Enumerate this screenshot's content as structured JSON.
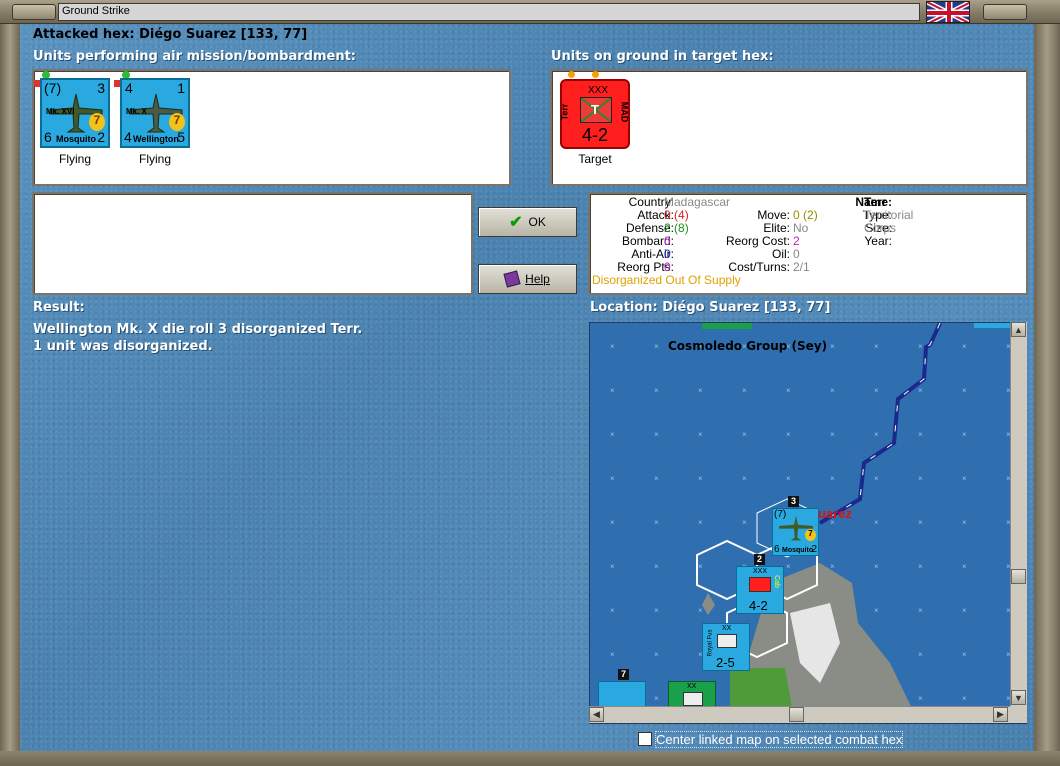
{
  "window": {
    "title": "Ground Strike"
  },
  "header": {
    "attacked_hex_label": "Attacked hex:",
    "attacked_hex_value": "Diégo Suarez  [133, 77]"
  },
  "air_units": {
    "heading": "Units performing air mission/bombardment:",
    "units": [
      {
        "name": "Mosquito",
        "model": "Mk. XVI",
        "top_left": "(7)",
        "top_right": "3",
        "bottom_left": "6",
        "bottom_right": "2",
        "badge": "7",
        "status": "Flying"
      },
      {
        "name": "Wellington",
        "model": "Mk. X",
        "top_left": "4",
        "top_right": "1",
        "bottom_left": "4",
        "bottom_right": "5",
        "badge": "7",
        "status": "Flying"
      }
    ]
  },
  "ground_units": {
    "heading": "Units on ground in target hex:",
    "units": [
      {
        "size": "XXX",
        "left_label": "Terr",
        "right_label": "MAD",
        "symbol": "T",
        "strength": "4-2",
        "status": "Target"
      }
    ]
  },
  "buttons": {
    "ok": "OK",
    "help": "Help"
  },
  "stats": {
    "country_label": "Country:",
    "country": "Madagascar",
    "attack_label": "Attack:",
    "attack": "0",
    "attack_max": "(4)",
    "defense_label": "Defense:",
    "defense": "2",
    "defense_max": "(8)",
    "bombard_label": "Bombard:",
    "bombard": "0",
    "antiair_label": "Anti-Air:",
    "antiair": "0",
    "reorg_pts_label": "Reorg Pts:",
    "reorg_pts": "0",
    "status": "Disorganized Out Of Supply",
    "move_label": "Move:",
    "move": "0",
    "move_max": "(2)",
    "elite_label": "Elite:",
    "elite": "No",
    "reorg_cost_label": "Reorg Cost:",
    "reorg_cost": "2",
    "oil_label": "Oil:",
    "oil": "0",
    "cost_turns_label": "Cost/Turns:",
    "cost_turns": "2/1",
    "name_label": "Name:",
    "name": "Terr",
    "type_label": "Type:",
    "type": "Territorial",
    "size_label": "Size:",
    "size": "Corps",
    "year_label": "Year:",
    "year": ""
  },
  "result": {
    "heading": "Result:",
    "lines": [
      "Wellington Mk. X die roll 3 disorganized Terr.",
      "1 unit was disorganized."
    ]
  },
  "location": {
    "label": "Location:",
    "value": "Diégo Suarez  [133, 77]"
  },
  "map": {
    "place_label": "Cosmoledo Group (Sey)",
    "city_label_partial": "uarez",
    "stack_counts": [
      "3",
      "2",
      "7"
    ],
    "counters": [
      {
        "name": "Mosquito",
        "top_left": "(7)",
        "bottom_left": "6",
        "bottom_right": "2",
        "badge": "7"
      },
      {
        "size": "XXX",
        "right_label": "Cab",
        "strength": "4-2"
      },
      {
        "size": "XX",
        "left_label": "Royal Fus",
        "strength": "2-5"
      },
      {
        "size": "XX",
        "strength": ""
      }
    ]
  },
  "checkbox": {
    "label": "Center linked map on selected combat hex",
    "checked": false
  },
  "colors": {
    "attack": "#e02020",
    "defense": "#209020",
    "bombard": "#c020c0",
    "antiair": "#2020d0",
    "reorg_pts": "#c020c0",
    "move": "#909000",
    "elite": "#888888",
    "status": "#e0a000",
    "unit_blue": "#29a9df",
    "target_red": "#ff1f1f"
  }
}
